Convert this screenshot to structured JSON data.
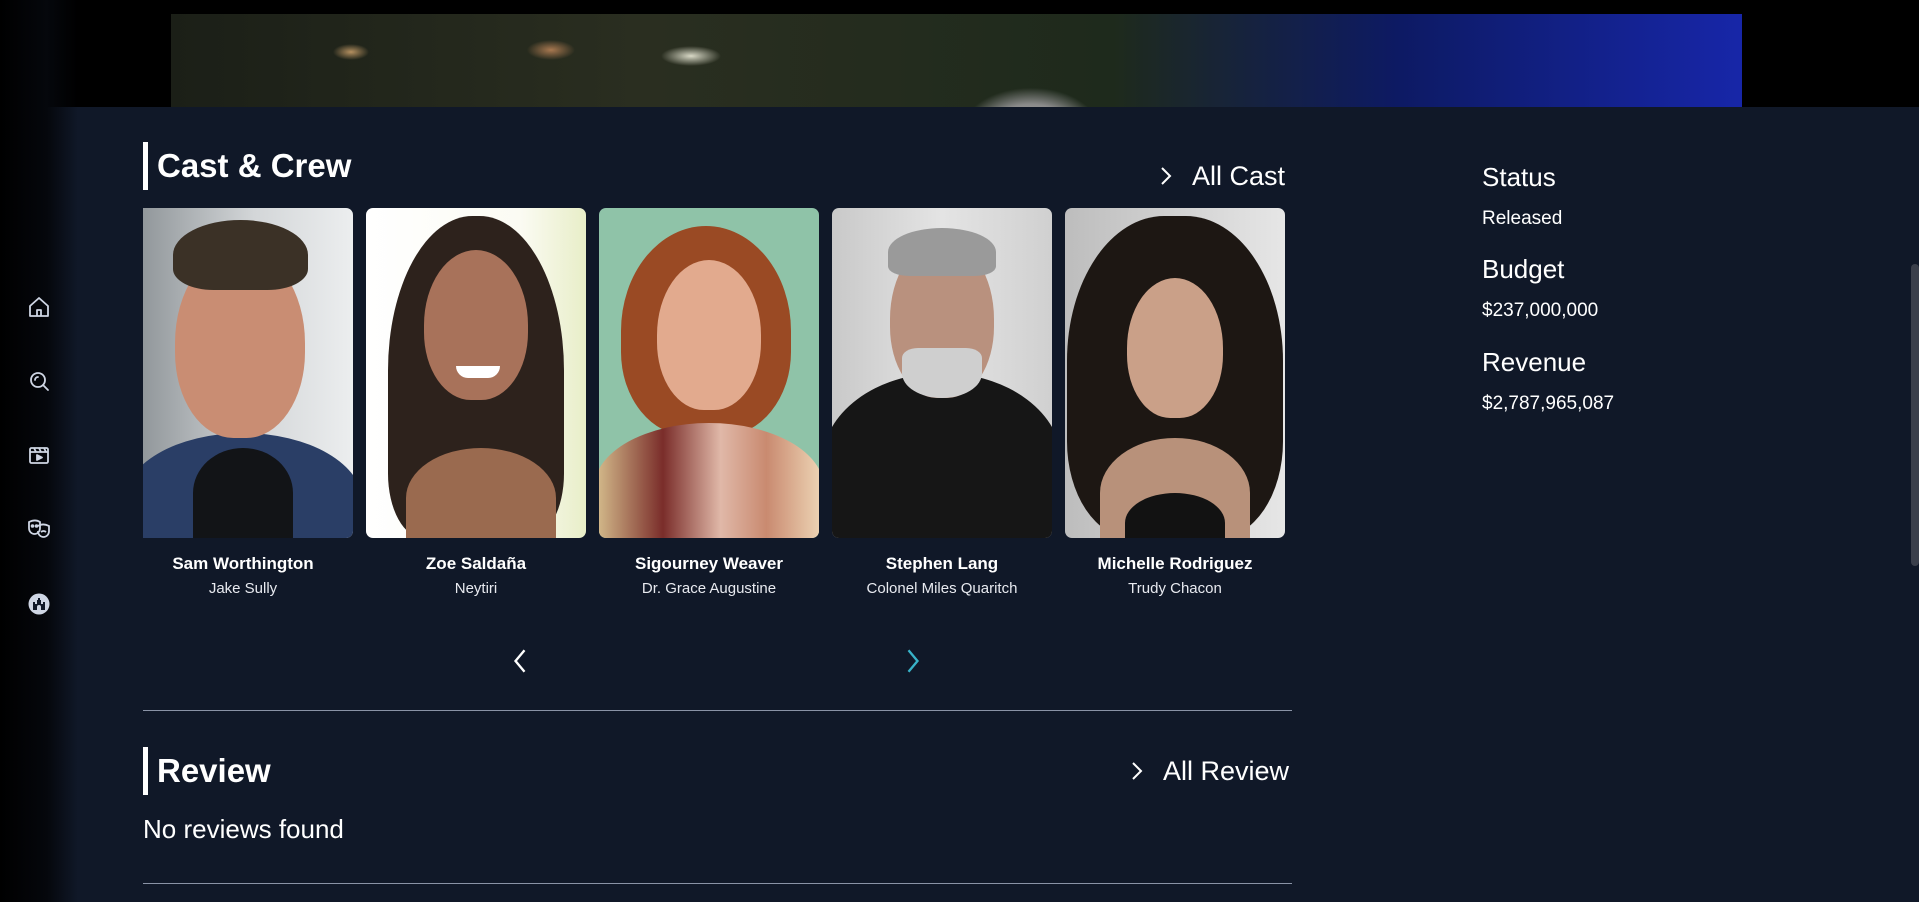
{
  "sidebar": {
    "items": [
      {
        "icon": "home-icon"
      },
      {
        "icon": "search-icon"
      },
      {
        "icon": "movie-icon"
      },
      {
        "icon": "theater-masks-icon"
      },
      {
        "icon": "castle-icon"
      }
    ]
  },
  "cast_section": {
    "title": "Cast & Crew",
    "all_link": "All Cast",
    "cast": [
      {
        "name": "Sam Worthington",
        "role": "Jake Sully"
      },
      {
        "name": "Zoe Saldaña",
        "role": "Neytiri"
      },
      {
        "name": "Sigourney Weaver",
        "role": "Dr. Grace Augustine"
      },
      {
        "name": "Stephen Lang",
        "role": "Colonel Miles Quaritch"
      },
      {
        "name": "Michelle Rodriguez",
        "role": "Trudy Chacon"
      }
    ]
  },
  "review_section": {
    "title": "Review",
    "all_link": "All Review",
    "empty_text": "No reviews found"
  },
  "info": {
    "status_label": "Status",
    "status_value": "Released",
    "budget_label": "Budget",
    "budget_value": "$237,000,000",
    "revenue_label": "Revenue",
    "revenue_value": "$2,787,965,087"
  },
  "colors": {
    "background": "#101828",
    "accent_arrow": "#38b2c8"
  }
}
